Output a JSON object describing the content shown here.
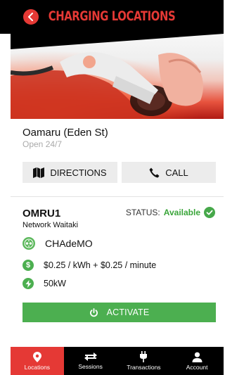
{
  "header": {
    "title": "CHARGING LOCATIONS",
    "back_icon": "chevron-left-icon",
    "accent_color": "#e53935"
  },
  "location": {
    "name": "Oamaru (Eden St)",
    "hours": "Open 24/7"
  },
  "actions": {
    "directions_label": "DIRECTIONS",
    "directions_icon": "map-icon",
    "call_label": "CALL",
    "call_icon": "phone-icon"
  },
  "charger": {
    "id": "OMRU1",
    "network": "Network Waitaki",
    "status_label": "STATUS:",
    "status_value": "Available",
    "status_color": "#3aa53a",
    "connector": "CHAdeMO",
    "connector_icon": "chademo-plug-icon",
    "price": "$0.25 / kWh + $0.25 / minute",
    "price_icon": "dollar-icon",
    "power": "50kW",
    "power_icon": "bolt-icon",
    "activate_label": "ACTIVATE",
    "activate_icon": "power-icon"
  },
  "tabs": [
    {
      "label": "Locations",
      "icon": "location-pin-icon",
      "active": true
    },
    {
      "label": "Sessions",
      "icon": "swap-arrows-icon",
      "active": false
    },
    {
      "label": "Transactions",
      "icon": "plug-icon",
      "active": false
    },
    {
      "label": "Account",
      "icon": "user-icon",
      "active": false
    }
  ]
}
